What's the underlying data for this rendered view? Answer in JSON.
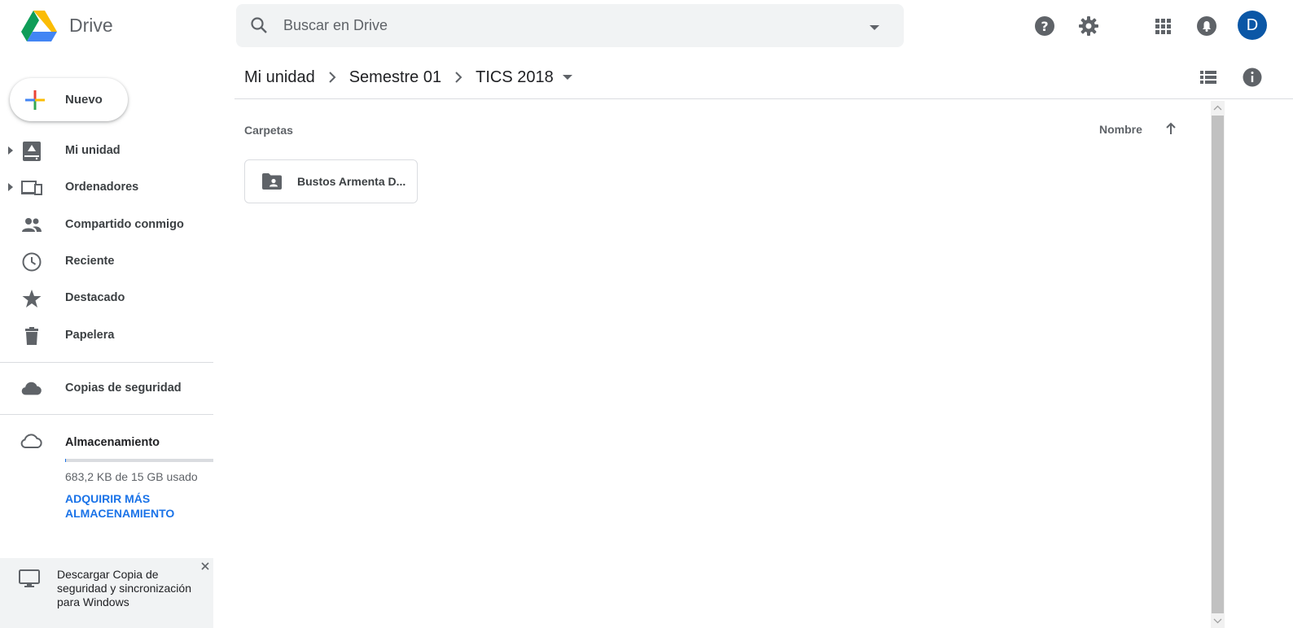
{
  "header": {
    "app_name": "Drive",
    "search_placeholder": "Buscar en Drive",
    "avatar_initial": "D"
  },
  "sidebar": {
    "new_label": "Nuevo",
    "items": [
      {
        "label": "Mi unidad",
        "icon": "my-drive-icon",
        "expandable": true
      },
      {
        "label": "Ordenadores",
        "icon": "computers-icon",
        "expandable": true
      },
      {
        "label": "Compartido conmigo",
        "icon": "shared-icon",
        "expandable": false
      },
      {
        "label": "Reciente",
        "icon": "clock-icon",
        "expandable": false
      },
      {
        "label": "Destacado",
        "icon": "star-icon",
        "expandable": false
      },
      {
        "label": "Papelera",
        "icon": "trash-icon",
        "expandable": false
      }
    ],
    "backups_label": "Copias de seguridad",
    "storage": {
      "label": "Almacenamiento",
      "usage_text": "683,2 KB de 15 GB usado",
      "buy_label": "ADQUIRIR MÁS ALMACENAMIENTO"
    },
    "promo_text": "Descargar Copia de seguridad y sincronización para Windows"
  },
  "breadcrumb": [
    "Mi unidad",
    "Semestre 01",
    "TICS 2018"
  ],
  "main": {
    "section_title": "Carpetas",
    "sort_label": "Nombre",
    "folders": [
      {
        "name": "Bustos Armenta D..."
      }
    ]
  },
  "colors": {
    "accent": "#1a73e8",
    "avatar": "#0b57a6",
    "icon_gray": "#5f6368"
  }
}
